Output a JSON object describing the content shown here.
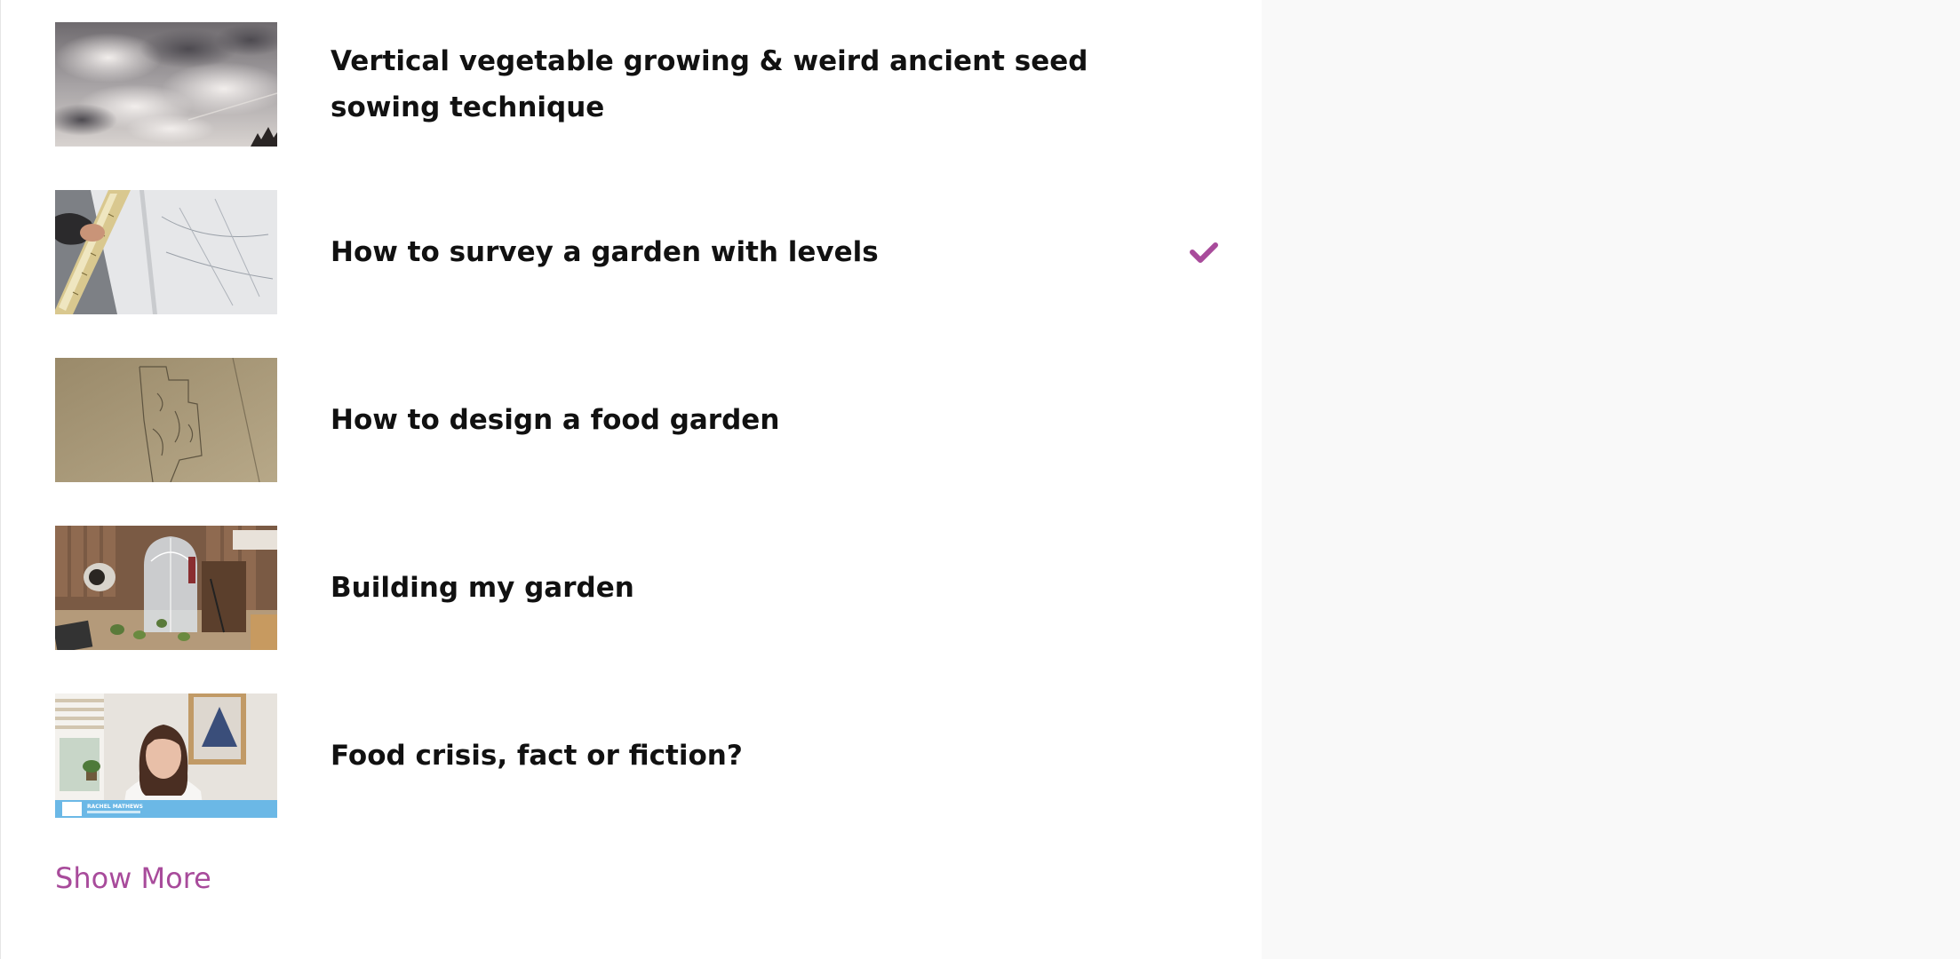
{
  "colors": {
    "accent": "#a84b9b",
    "title_text": "#111111",
    "right_panel_bg": "#f9f9f9"
  },
  "videos": [
    {
      "title": "Vertical vegetable growing & weird ancient seed sowing technique",
      "watched": false,
      "thumb": "cloudy-sky"
    },
    {
      "title": "How to survey a garden with levels",
      "watched": true,
      "thumb": "survey-plan"
    },
    {
      "title": "How to design a food garden",
      "watched": false,
      "thumb": "garden-sketch"
    },
    {
      "title": "Building my garden",
      "watched": false,
      "thumb": "garden-build"
    },
    {
      "title": "Food crisis, fact or fiction?",
      "watched": false,
      "thumb": "presenter"
    }
  ],
  "show_more_label": "Show More",
  "thumb_caption": "RACHEL MATHEWS"
}
